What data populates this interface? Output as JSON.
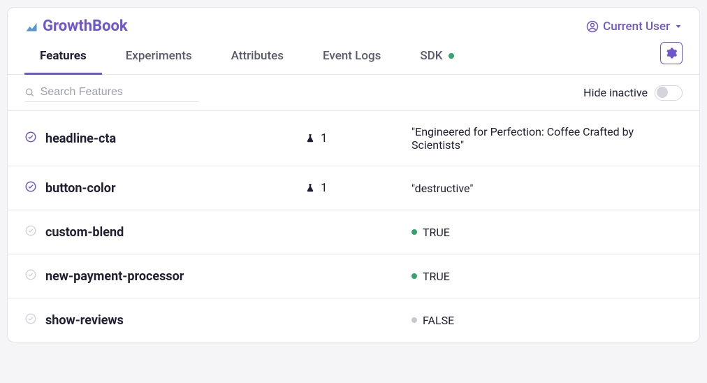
{
  "header": {
    "logo_text": "GrowthBook",
    "user_label": "Current User"
  },
  "tabs": [
    {
      "label": "Features",
      "active": true
    },
    {
      "label": "Experiments",
      "active": false
    },
    {
      "label": "Attributes",
      "active": false
    },
    {
      "label": "Event Logs",
      "active": false
    },
    {
      "label": "SDK",
      "active": false,
      "has_dot": true
    }
  ],
  "filter": {
    "search_placeholder": "Search Features",
    "hide_inactive_label": "Hide inactive"
  },
  "features": [
    {
      "name": "headline-cta",
      "status": "active",
      "experiments": "1",
      "value_type": "string",
      "value": "\"Engineered for Perfection: Coffee Crafted by Scientists\""
    },
    {
      "name": "button-color",
      "status": "active",
      "experiments": "1",
      "value_type": "string",
      "value": "\"destructive\""
    },
    {
      "name": "custom-blend",
      "status": "inactive",
      "experiments": "",
      "value_type": "bool",
      "value": "TRUE"
    },
    {
      "name": "new-payment-processor",
      "status": "inactive",
      "experiments": "",
      "value_type": "bool",
      "value": "TRUE"
    },
    {
      "name": "show-reviews",
      "status": "inactive",
      "experiments": "",
      "value_type": "bool",
      "value": "FALSE"
    }
  ]
}
